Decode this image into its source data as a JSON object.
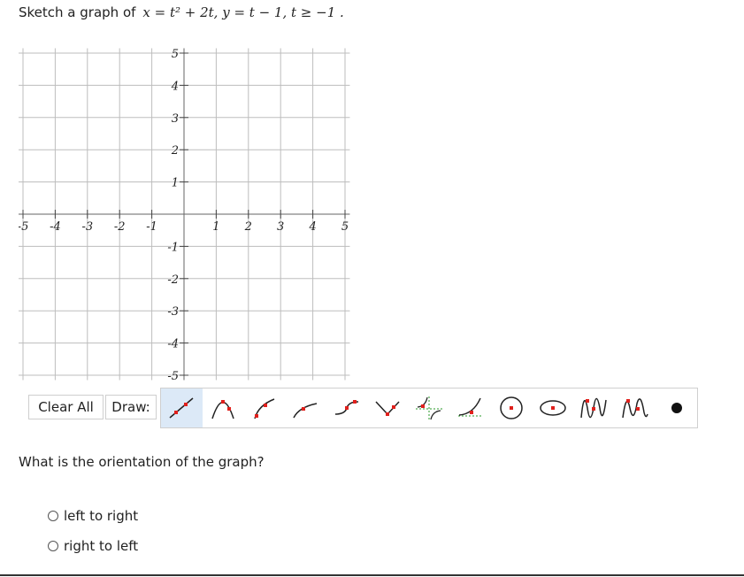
{
  "question": {
    "prefix": "Sketch a graph of",
    "equation": "x = t² + 2t, y = t − 1, t ≥ −1 ."
  },
  "graph": {
    "x_ticks": [
      "-5",
      "-4",
      "-3",
      "-2",
      "-1",
      "1",
      "2",
      "3",
      "4",
      "5"
    ],
    "y_ticks_pos": [
      "5",
      "4",
      "3",
      "2",
      "1"
    ],
    "y_ticks_neg": [
      "-1",
      "-2",
      "-3",
      "-4",
      "-5"
    ],
    "x_range": [
      -5,
      5
    ],
    "y_range": [
      -5,
      5
    ],
    "grid": true
  },
  "toolbar": {
    "clear_label": "Clear All",
    "draw_label": "Draw:",
    "tools": [
      "line",
      "parabola",
      "sqrt",
      "log",
      "cubic",
      "absolute-value",
      "rational",
      "exponential",
      "circle",
      "ellipse",
      "sine",
      "cosine",
      "point"
    ],
    "selected_tool": "line",
    "accent_color": "#e0201c"
  },
  "orientation": {
    "prompt": "What is the orientation of the graph?",
    "options": [
      "left to right",
      "right to left"
    ]
  }
}
